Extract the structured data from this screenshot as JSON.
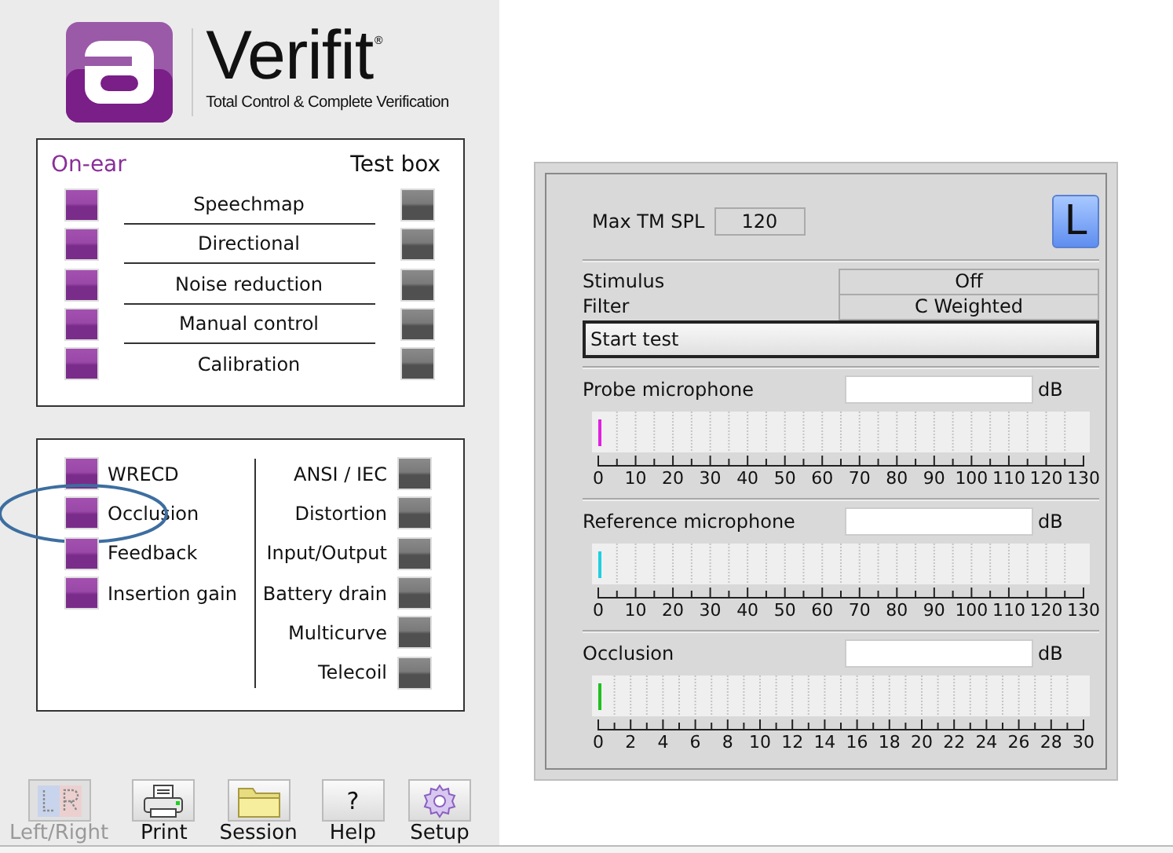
{
  "logo": {
    "name": "Verifit",
    "mark": "®",
    "tagline": "Total Control & Complete Verification"
  },
  "test_panel": {
    "left_heading": "On-ear",
    "right_heading": "Test box",
    "tests": [
      {
        "label": "Speechmap"
      },
      {
        "label": "Directional"
      },
      {
        "label": "Noise reduction"
      },
      {
        "label": "Manual control"
      },
      {
        "label": "Calibration"
      }
    ]
  },
  "more_tests": {
    "left": [
      {
        "label": "WRECD",
        "circled": false
      },
      {
        "label": "Occlusion",
        "circled": true
      },
      {
        "label": "Feedback",
        "circled": false
      },
      {
        "label": "Insertion gain",
        "circled": false
      }
    ],
    "right": [
      {
        "label": "ANSI / IEC"
      },
      {
        "label": "Distortion"
      },
      {
        "label": "Input/Output"
      },
      {
        "label": "Battery drain"
      },
      {
        "label": "Multicurve"
      },
      {
        "label": "Telecoil"
      }
    ]
  },
  "toolbar": [
    {
      "label": "Left/Right",
      "kind": "lr",
      "disabled": true
    },
    {
      "label": "Print",
      "kind": "printer",
      "disabled": false
    },
    {
      "label": "Session",
      "kind": "folder",
      "disabled": false
    },
    {
      "label": "Help",
      "kind": "symbol",
      "symbol": "?",
      "disabled": false
    },
    {
      "label": "Setup",
      "kind": "gear",
      "disabled": false
    }
  ],
  "measurement": {
    "max_label": "Max TM SPL",
    "max_value": "120",
    "side_button": "L",
    "settings": [
      {
        "label": "Stimulus",
        "value": "Off"
      },
      {
        "label": "Filter",
        "value": "C Weighted"
      }
    ],
    "start_button": "Start test",
    "meters": [
      {
        "label": "Probe microphone",
        "unit": "dB",
        "level": 0,
        "color": "#e020e0",
        "ticks": [
          "0",
          "10",
          "20",
          "30",
          "40",
          "50",
          "60",
          "70",
          "80",
          "90",
          "100",
          "110",
          "120",
          "130"
        ]
      },
      {
        "label": "Reference microphone",
        "unit": "dB",
        "level": 0,
        "color": "#20d0e0",
        "ticks": [
          "0",
          "10",
          "20",
          "30",
          "40",
          "50",
          "60",
          "70",
          "80",
          "90",
          "100",
          "110",
          "120",
          "130"
        ]
      },
      {
        "label": "Occlusion",
        "unit": "dB",
        "level": 0,
        "color": "#20c020",
        "ticks": [
          "0",
          "2",
          "4",
          "6",
          "8",
          "10",
          "12",
          "14",
          "16",
          "18",
          "20",
          "22",
          "24",
          "26",
          "28",
          "30"
        ]
      }
    ]
  }
}
